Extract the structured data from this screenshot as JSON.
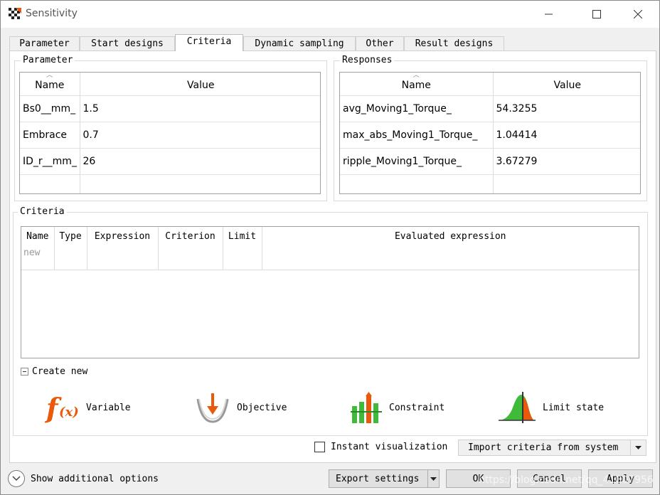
{
  "window": {
    "title": "Sensitivity"
  },
  "tabs": [
    {
      "label": "Parameter"
    },
    {
      "label": "Start designs"
    },
    {
      "label": "Criteria",
      "active": true
    },
    {
      "label": "Dynamic sampling"
    },
    {
      "label": "Other"
    },
    {
      "label": "Result designs"
    }
  ],
  "parameter_group": {
    "title": "Parameter",
    "headers": {
      "name": "Name",
      "value": "Value"
    },
    "rows": [
      {
        "name": "Bs0__mm_",
        "value": "1.5"
      },
      {
        "name": "Embrace",
        "value": "0.7"
      },
      {
        "name": "ID_r__mm_",
        "value": "26"
      }
    ]
  },
  "responses_group": {
    "title": "Responses",
    "headers": {
      "name": "Name",
      "value": "Value"
    },
    "rows": [
      {
        "name": "avg_Moving1_Torque_",
        "value": "54.3255"
      },
      {
        "name": "max_abs_Moving1_Torque_",
        "value": "1.04414"
      },
      {
        "name": "ripple_Moving1_Torque_",
        "value": "3.67279"
      }
    ]
  },
  "criteria_group": {
    "title": "Criteria",
    "headers": [
      "Name",
      "Type",
      "Expression",
      "Criterion",
      "Limit",
      "Evaluated expression"
    ],
    "new_row_placeholder": "new"
  },
  "create_new": {
    "label": "Create new",
    "tools": [
      {
        "label": "Variable",
        "icon": "function-fx-icon"
      },
      {
        "label": "Objective",
        "icon": "objective-icon"
      },
      {
        "label": "Constraint",
        "icon": "constraint-icon"
      },
      {
        "label": "Limit state",
        "icon": "limit-state-icon"
      }
    ]
  },
  "instant_visualization": {
    "label": "Instant visualization",
    "checked": false
  },
  "import_criteria": {
    "label": "Import criteria from system"
  },
  "footer": {
    "show_options": "Show additional options",
    "export_settings": "Export settings",
    "ok": "OK",
    "cancel": "Cancel",
    "apply": "Apply"
  },
  "watermark": "https://blog.csdn.net/qq_41807956",
  "colors": {
    "accent_orange": "#e8590c",
    "green": "#3fba3a",
    "tab_active": "#ffffff"
  }
}
